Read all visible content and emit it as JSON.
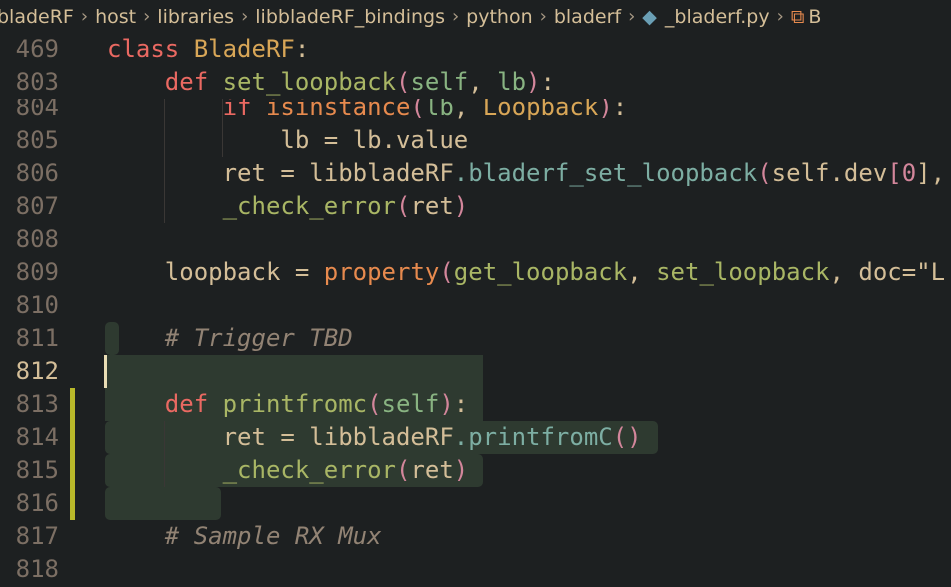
{
  "breadcrumb": [
    "bladeRF",
    "host",
    "libraries",
    "libbladeRF_bindings",
    "python",
    "bladerf",
    "_bladerf.py",
    "B"
  ],
  "sticky": [
    {
      "n": "469",
      "tokens": [
        [
          "class ",
          "k"
        ],
        [
          "BladeRF",
          "y"
        ],
        [
          ":",
          "f"
        ]
      ]
    },
    {
      "n": "803",
      "tokens": [
        [
          "    ",
          "f"
        ],
        [
          "def ",
          "k"
        ],
        [
          "set_loopback",
          "g"
        ],
        [
          "(",
          "p"
        ],
        [
          "self",
          "a"
        ],
        [
          ", ",
          "f"
        ],
        [
          "lb",
          "a"
        ],
        [
          ")",
          "p"
        ],
        [
          ":",
          "f"
        ]
      ]
    }
  ],
  "lines": [
    {
      "n": "804",
      "tokens": [
        [
          "        ",
          "f"
        ],
        [
          "if ",
          "k"
        ],
        [
          "isinstance",
          "o"
        ],
        [
          "(",
          "p"
        ],
        [
          "lb",
          "a"
        ],
        [
          ", ",
          "f"
        ],
        [
          "Loopback",
          "y"
        ],
        [
          ")",
          "p"
        ],
        [
          ":",
          "f"
        ]
      ]
    },
    {
      "n": "805",
      "tokens": [
        [
          "            lb = lb.value",
          "f"
        ]
      ]
    },
    {
      "n": "806",
      "tokens": [
        [
          "        ret = libbladeRF",
          "f"
        ],
        [
          ".bladerf_set_loopback",
          "b"
        ],
        [
          "(",
          "p"
        ],
        [
          "self",
          "f"
        ],
        [
          ".dev",
          "f"
        ],
        [
          "[",
          "p"
        ],
        [
          "0",
          "p"
        ],
        [
          "], ",
          "f"
        ]
      ]
    },
    {
      "n": "807",
      "tokens": [
        [
          "        ",
          "f"
        ],
        [
          "_check_error",
          "g"
        ],
        [
          "(",
          "p"
        ],
        [
          "ret",
          "f"
        ],
        [
          ")",
          "p"
        ]
      ]
    },
    {
      "n": "808",
      "tokens": []
    },
    {
      "n": "809",
      "tokens": [
        [
          "    loopback = ",
          "f"
        ],
        [
          "property",
          "o"
        ],
        [
          "(",
          "p"
        ],
        [
          "get_loopback",
          "g"
        ],
        [
          ", ",
          "f"
        ],
        [
          "set_loopback",
          "g"
        ],
        [
          ", doc=\"L",
          "f"
        ]
      ]
    },
    {
      "n": "810",
      "tokens": []
    },
    {
      "n": "811",
      "tokens": [
        [
          "    ",
          "f"
        ],
        [
          "# Trigger TBD",
          "c"
        ]
      ]
    },
    {
      "n": "812",
      "tokens": [],
      "current": true
    },
    {
      "n": "813",
      "tokens": [
        [
          "    ",
          "f"
        ],
        [
          "def ",
          "k"
        ],
        [
          "printfromc",
          "g"
        ],
        [
          "(",
          "p"
        ],
        [
          "self",
          "a"
        ],
        [
          ")",
          "p"
        ],
        [
          ":",
          "f"
        ]
      ]
    },
    {
      "n": "814",
      "tokens": [
        [
          "        ret = libbladeRF",
          "f"
        ],
        [
          ".printfromC",
          "b"
        ],
        [
          "()",
          "p"
        ]
      ]
    },
    {
      "n": "815",
      "tokens": [
        [
          "        ",
          "f"
        ],
        [
          "_check_error",
          "g"
        ],
        [
          "(",
          "p"
        ],
        [
          "ret",
          "f"
        ],
        [
          ")",
          "p"
        ]
      ]
    },
    {
      "n": "816",
      "tokens": []
    },
    {
      "n": "817",
      "tokens": [
        [
          "    ",
          "f"
        ],
        [
          "# Sample RX Mux",
          "c"
        ]
      ]
    },
    {
      "n": "818",
      "tokens": []
    }
  ]
}
